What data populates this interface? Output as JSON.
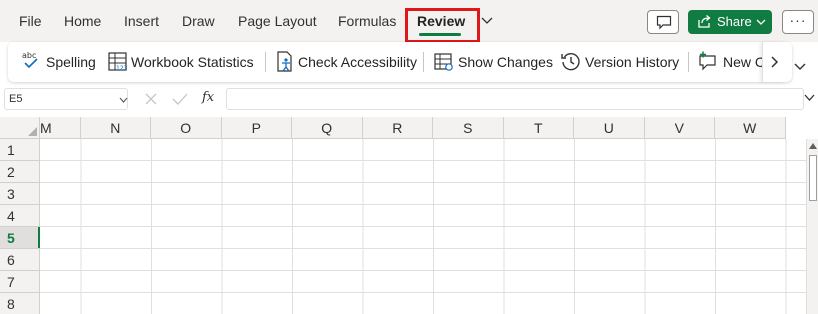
{
  "menu": {
    "tabs": [
      {
        "label": "File"
      },
      {
        "label": "Home"
      },
      {
        "label": "Insert"
      },
      {
        "label": "Draw"
      },
      {
        "label": "Page Layout"
      },
      {
        "label": "Formulas"
      },
      {
        "label": "Review"
      }
    ],
    "active_tab": "Review",
    "share_label": "Share",
    "more_label": "···"
  },
  "ribbon": {
    "items": [
      {
        "label": "Spelling",
        "icon": "spelling-icon"
      },
      {
        "label": "Workbook Statistics",
        "icon": "workbook-statistics-icon"
      },
      {
        "label": "Check Accessibility",
        "icon": "accessibility-icon"
      },
      {
        "label": "Show Changes",
        "icon": "show-changes-icon"
      },
      {
        "label": "Version History",
        "icon": "version-history-icon"
      },
      {
        "label": "New C",
        "icon": "new-comment-icon"
      }
    ]
  },
  "formula_bar": {
    "name_box": "E5",
    "fx_label": "fx",
    "formula": ""
  },
  "grid": {
    "columns": [
      "M",
      "N",
      "O",
      "P",
      "Q",
      "R",
      "S",
      "T",
      "U",
      "V",
      "W"
    ],
    "rows": [
      "1",
      "2",
      "3",
      "4",
      "5",
      "6",
      "7",
      "8"
    ],
    "active_row": "5"
  },
  "colors": {
    "accent": "#107c41",
    "highlight": "#e0171a"
  }
}
